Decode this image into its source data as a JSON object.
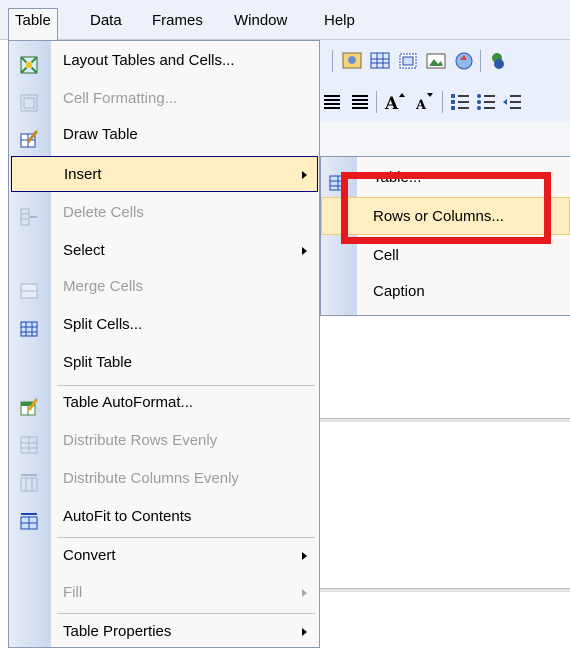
{
  "menubar": {
    "items": [
      {
        "label": "Table",
        "active": true
      },
      {
        "label": "Data"
      },
      {
        "label": "Frames"
      },
      {
        "label": "Window"
      },
      {
        "label": "Help"
      }
    ]
  },
  "table_menu": {
    "items": [
      {
        "label": "Layout Tables and Cells...",
        "icon": "layout-table-icon",
        "enabled": true
      },
      {
        "label": "Cell Formatting...",
        "icon": "cell-formatting-icon",
        "enabled": false
      },
      {
        "label": "Draw Table",
        "icon": "draw-table-icon",
        "enabled": true
      },
      {
        "label": "Insert",
        "icon": "",
        "enabled": true,
        "submenu": true,
        "highlighted": true
      },
      {
        "label": "Delete Cells",
        "icon": "delete-cells-icon",
        "enabled": false
      },
      {
        "label": "Select",
        "icon": "",
        "enabled": true,
        "submenu": true
      },
      {
        "label": "Merge Cells",
        "icon": "merge-cells-icon",
        "enabled": false
      },
      {
        "label": "Split Cells...",
        "icon": "split-cells-icon",
        "enabled": true
      },
      {
        "label": "Split Table",
        "icon": "",
        "enabled": true
      },
      {
        "label": "Table AutoFormat...",
        "icon": "table-autoformat-icon",
        "enabled": true
      },
      {
        "label": "Distribute Rows Evenly",
        "icon": "distribute-rows-icon",
        "enabled": false
      },
      {
        "label": "Distribute Columns Evenly",
        "icon": "distribute-columns-icon",
        "enabled": false
      },
      {
        "label": "AutoFit to Contents",
        "icon": "autofit-icon",
        "enabled": true
      },
      {
        "label": "Convert",
        "icon": "",
        "enabled": true,
        "submenu": true
      },
      {
        "label": "Fill",
        "icon": "",
        "enabled": false,
        "submenu": true
      },
      {
        "label": "Table Properties",
        "icon": "",
        "enabled": true,
        "submenu": true
      }
    ]
  },
  "insert_submenu": {
    "items": [
      {
        "label": "Table...",
        "icon": "insert-table-icon"
      },
      {
        "label": "Rows or Columns...",
        "highlighted": true
      },
      {
        "label": "Cell"
      },
      {
        "label": "Caption"
      }
    ]
  },
  "colors": {
    "highlight_fill": "#ffeec2",
    "highlight_border": "#000080",
    "annotation_red": "#e8191c",
    "gutter": "#c9d6ee",
    "disabled_text": "#9c9c9c"
  }
}
